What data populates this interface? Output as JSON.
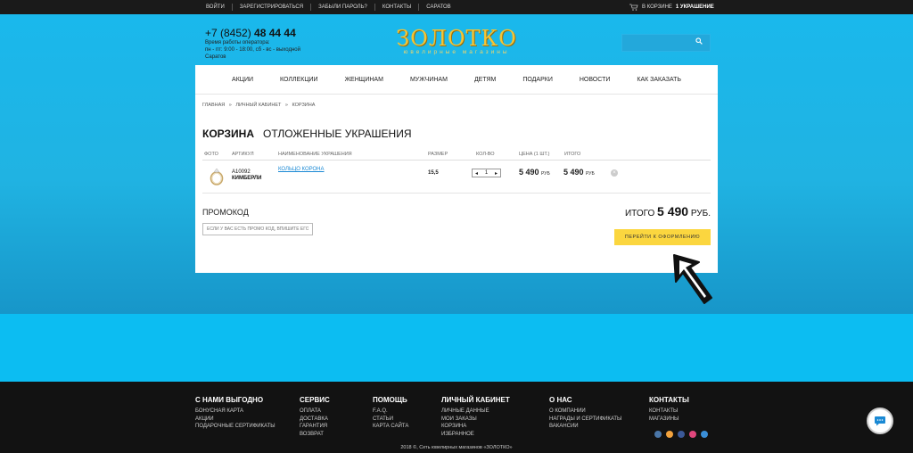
{
  "topbar": {
    "links": [
      "ВОЙТИ",
      "ЗАРЕГИСТРИРОВАТЬСЯ",
      "ЗАБЫЛИ ПАРОЛЬ?",
      "КОНТАКТЫ",
      "САРАТОВ"
    ],
    "cart_prefix": "В КОРЗИНЕ",
    "cart_count": "1 УКРАШЕНИЕ"
  },
  "header": {
    "phone_code": "+7 (8452)",
    "phone_number": "48 44 44",
    "hours_line1": "Время работы оператора:",
    "hours_line2": "пн - пт: 9:00 - 18:00, сб - вс - выходной",
    "hours_line3": "Саратов",
    "logo_main": "ЗОЛОТКО",
    "logo_sub": "ювелирные магазины"
  },
  "main_nav": [
    "АКЦИИ",
    "КОЛЛЕКЦИИ",
    "ЖЕНЩИНАМ",
    "МУЖЧИНАМ",
    "ДЕТЯМ",
    "ПОДАРКИ",
    "НОВОСТИ",
    "КАК ЗАКАЗАТЬ"
  ],
  "breadcrumb": [
    "ГЛАВНАЯ",
    "»",
    "ЛИЧНЫЙ КАБИНЕТ",
    "»",
    "КОРЗИНА"
  ],
  "tabs": [
    "КОРЗИНА",
    "ОТЛОЖЕННЫЕ УКРАШЕНИЯ"
  ],
  "table": {
    "headers": [
      "ФОТО",
      "АРТИКУЛ",
      "НАИМЕНОВАНИЕ УКРАШЕНИЯ",
      "РАЗМЕР",
      "КОЛ-ВО",
      "ЦЕНА (1 ШТ.)",
      "ИТОГО"
    ],
    "row": {
      "article": "А10092",
      "brand": "КИМБЕРЛИ",
      "name": "КОЛЬЦО КОРОНА",
      "size": "15,5",
      "qty": "1",
      "price": "5 490",
      "price_unit": "РУБ",
      "total": "5 490",
      "total_unit": "РУБ"
    }
  },
  "promo": {
    "title": "ПРОМОКОД",
    "placeholder": "ЕСЛИ У ВАС ЕСТЬ ПРОМО КОД, ВПИШИТЕ ЕГО"
  },
  "summary": {
    "label": "ИТОГО",
    "amount": "5 490",
    "unit": "РУБ."
  },
  "checkout_label": "ПЕРЕЙТИ К ОФОРМЛЕНИЮ",
  "footer": {
    "cols": [
      {
        "title": "С НАМИ ВЫГОДНО",
        "links": [
          "БОНУСНАЯ КАРТА",
          "АКЦИИ",
          "ПОДАРОЧНЫЕ СЕРТИФИКАТЫ"
        ]
      },
      {
        "title": "СЕРВИС",
        "links": [
          "ОПЛАТА",
          "ДОСТАВКА",
          "ГАРАНТИЯ",
          "ВОЗВРАТ"
        ]
      },
      {
        "title": "ПОМОЩЬ",
        "links": [
          "F.A.Q.",
          "СТАТЬИ",
          "КАРТА САЙТА"
        ]
      },
      {
        "title": "ЛИЧНЫЙ КАБИНЕТ",
        "links": [
          "ЛИЧНЫЕ ДАННЫЕ",
          "МОИ ЗАКАЗЫ",
          "КОРЗИНА",
          "ИЗБРАННОЕ"
        ]
      },
      {
        "title": "О НАС",
        "links": [
          "О КОМПАНИИ",
          "НАГРАДЫ И СЕРТИФИКАТЫ",
          "ВАКАНСИИ"
        ]
      },
      {
        "title": "КОНТАКТЫ",
        "links": [
          "КОНТАКТЫ",
          "МАГАЗИНЫ"
        ]
      }
    ],
    "social_icons": [
      "vk-icon",
      "odnoklassniki-icon",
      "facebook-icon",
      "instagram-icon",
      "email-icon"
    ],
    "copyright": "2018 ©, Сеть ювелирных магазинов «ЗОЛОТКО»"
  },
  "colors": {
    "accent_yellow": "#fbd63f",
    "background_blue": "#0fb4e8",
    "link_blue": "#1a89d4",
    "logo_gold": "#f3c437"
  }
}
